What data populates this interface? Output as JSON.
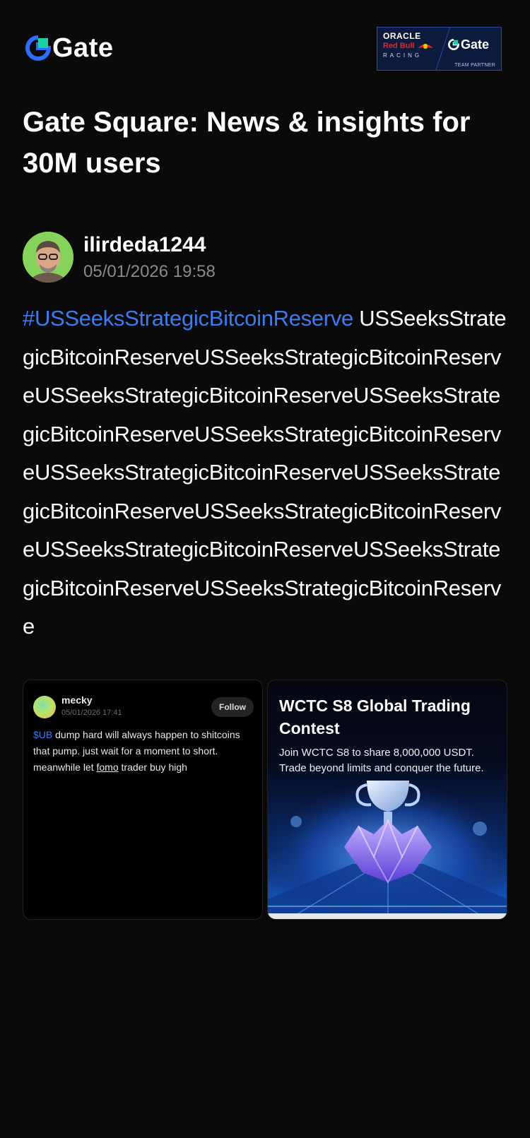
{
  "header": {
    "brand_name": "Gate",
    "partner": {
      "oracle": "ORACLE",
      "redbull": "Red Bull",
      "racing": "RACING",
      "gate": "Gate",
      "team": "TEAM PARTNER"
    }
  },
  "page_title": "Gate Square: News & insights for 30M users",
  "author": {
    "name": "ilirdeda1244",
    "date": "05/01/2026 19:58"
  },
  "post": {
    "hashtag": "#USSeeksStrategicBitcoinReserve",
    "body": " USSeeksStrategicBitcoinReserveUSSeeksStrategicBitcoinReserveUSSeeksStrategicBitcoinReserveUSSeeksStrategicBitcoinReserveUSSeeksStrategicBitcoinReserveUSSeeksStrategicBitcoinReserveUSSeeksStrategicBitcoinReserveUSSeeksStrategicBitcoinReserveUSSeeksStrategicBitcoinReserveUSSeeksStrategicBitcoinReserveUSSeeksStrategicBitcoinReserve"
  },
  "images": {
    "card1": {
      "name": "mecky",
      "date": "05/01/2026 17:41",
      "follow": "Follow",
      "tag": "$UB",
      "line1": " dump hard will always happen to shitcoins that pump. just wait for a moment to short.",
      "line2_pre": "meanwhile let ",
      "line2_u": "fomo",
      "line2_post": " trader buy high"
    },
    "card2": {
      "title": "WCTC S8 Global Trading Contest",
      "subtitle": "Join WCTC S8 to share 8,000,000 USDT. Trade beyond limits and conquer the future."
    }
  },
  "colors": {
    "background": "#0a0a0a",
    "hashtag": "#3d7bf0",
    "muted": "#8a8a8a"
  }
}
